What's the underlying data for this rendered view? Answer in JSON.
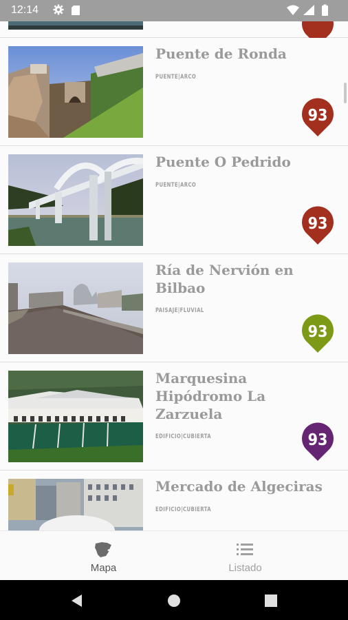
{
  "status_bar": {
    "time": "12:14",
    "icons": [
      "settings-icon",
      "sd-card-icon",
      "wifi-icon",
      "signal-icon",
      "battery-icon"
    ]
  },
  "colors": {
    "pin_red": "#a3301f",
    "pin_green": "#7c9a16",
    "pin_purple": "#662572",
    "title_gray": "#9a9a9a"
  },
  "cards": [
    {
      "title": "Puente de Ronda",
      "category": "PUENTE|ARCO",
      "score": "93",
      "pin_color": "#a3301f",
      "thumb": "ronda-bridge-photo"
    },
    {
      "title": "Puente O Pedrido",
      "category": "PUENTE|ARCO",
      "score": "93",
      "pin_color": "#a3301f",
      "thumb": "pedrido-bridge-photo"
    },
    {
      "title": "Ría de Nervión en Bilbao",
      "category": "PAISAJE|FLUVIAL",
      "score": "93",
      "pin_color": "#7c9a16",
      "thumb": "bilbao-river-photo"
    },
    {
      "title": "Marquesina Hipódromo La Zarzuela",
      "category": "EDIFICIO|CUBIERTA",
      "score": "93",
      "pin_color": "#662572",
      "thumb": "zarzuela-hippodrome-photo"
    },
    {
      "title": "Mercado de Algeciras",
      "category": "EDIFICIO|CUBIERTA",
      "score": "",
      "pin_color": "#662572",
      "thumb": "algeciras-market-photo"
    }
  ],
  "bottom_nav": {
    "map_label": "Mapa",
    "list_label": "Listado"
  }
}
